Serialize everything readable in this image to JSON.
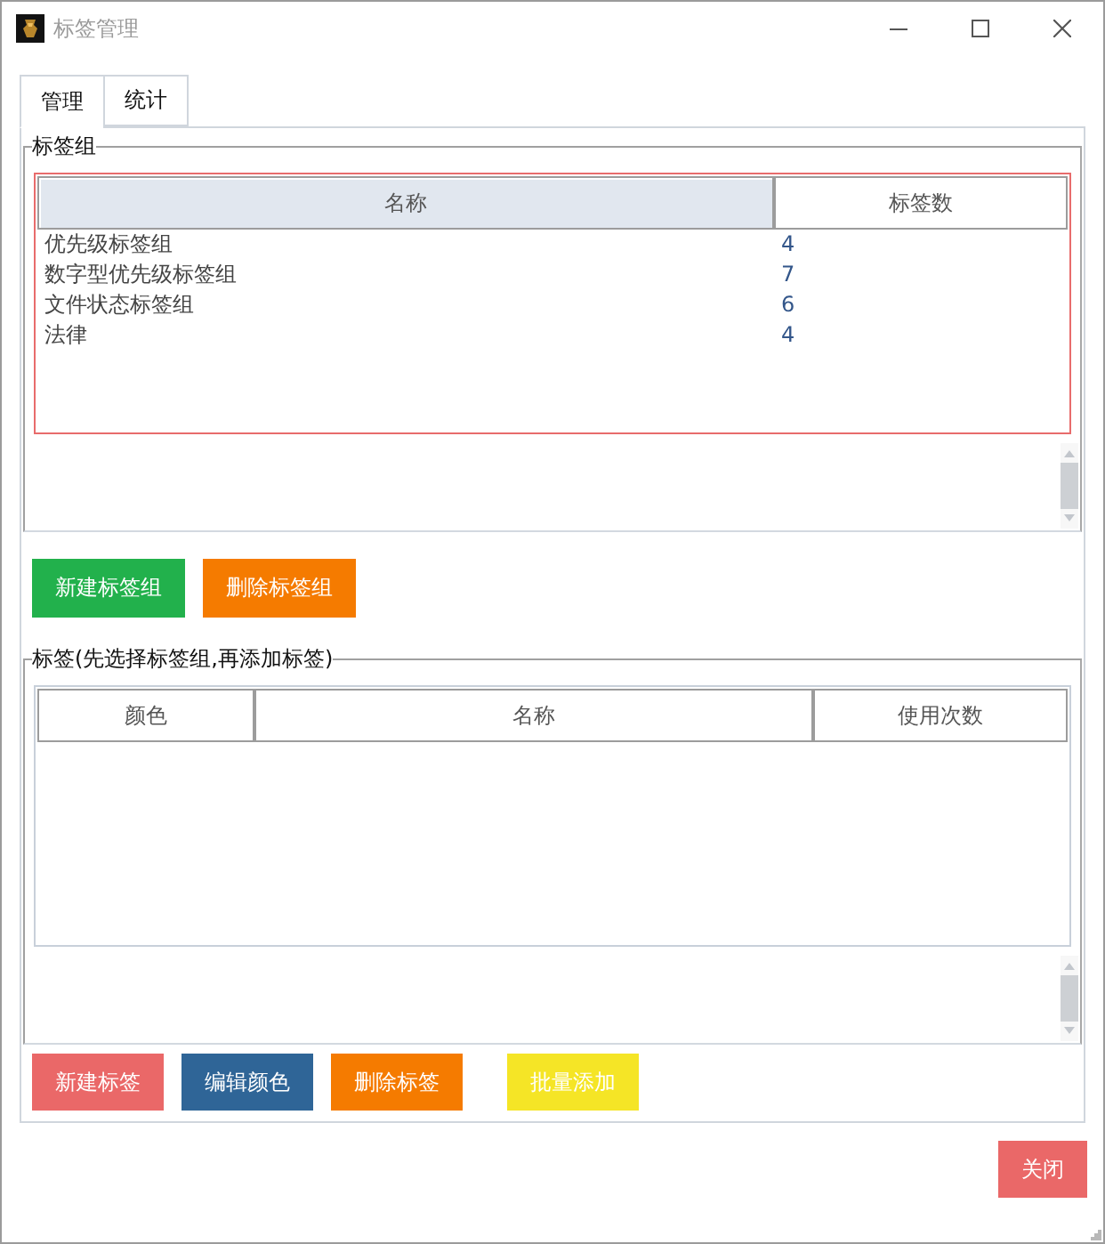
{
  "window": {
    "title": "标签管理"
  },
  "tabs": [
    {
      "label": "管理",
      "selected": true
    },
    {
      "label": "统计",
      "selected": false
    }
  ],
  "tag_groups": {
    "legend": "标签组",
    "focused": true,
    "columns": [
      {
        "label": "名称",
        "highlighted": true
      },
      {
        "label": "标签数",
        "highlighted": false
      }
    ],
    "rows": [
      {
        "name": "优先级标签组",
        "count": "4"
      },
      {
        "name": "数字型优先级标签组",
        "count": "7"
      },
      {
        "name": "文件状态标签组",
        "count": "6"
      },
      {
        "name": "法律",
        "count": "4"
      }
    ]
  },
  "group_buttons": [
    {
      "label": "新建标签组",
      "color": "#22b14c"
    },
    {
      "label": "删除标签组",
      "color": "#f57b00"
    }
  ],
  "tags": {
    "legend": "标签(先选择标签组,再添加标签)",
    "focused": false,
    "columns": [
      {
        "label": "颜色",
        "highlighted": false
      },
      {
        "label": "名称",
        "highlighted": false
      },
      {
        "label": "使用次数",
        "highlighted": false
      }
    ]
  },
  "tag_buttons": [
    {
      "label": "新建标签",
      "color": "#ea6868"
    },
    {
      "label": "编辑颜色",
      "color": "#2f6597"
    },
    {
      "label": "删除标签",
      "color": "#f57b00"
    },
    {
      "label": "批量添加",
      "color": "#f5e526"
    }
  ],
  "close_button": {
    "label": "关闭"
  }
}
